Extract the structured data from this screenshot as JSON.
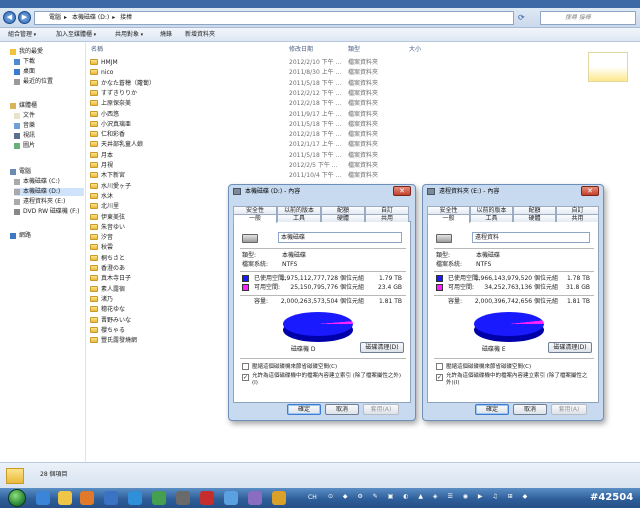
{
  "address": {
    "crumbs": [
      "電腦",
      "本機磁碟 (D:)",
      "接棒"
    ],
    "search_placeholder": "搜尋 接棒"
  },
  "toolbar": {
    "organize": "組合管理",
    "include_library": "加入至媒體櫃",
    "share": "共用對象",
    "burn": "燒錄",
    "new_folder": "新增資料夾"
  },
  "nav": {
    "favorites": "我的最愛",
    "downloads": "下載",
    "desktop": "桌面",
    "recent": "最近的位置",
    "libraries": "媒體櫃",
    "documents": "文件",
    "music": "音樂",
    "videos": "視訊",
    "pictures": "圖片",
    "computer": "電腦",
    "drive_c": "本機磁碟 (C:)",
    "drive_d": "本機磁碟 (D:)",
    "drive_e": "遠程資料夾 (E:)",
    "dvd": "DVD RW 磁碟機 (F:)",
    "network": "網路"
  },
  "columns": {
    "name": "名稱",
    "date": "修改日期",
    "type": "類型",
    "size": "大小"
  },
  "files": [
    {
      "name": "HMJM",
      "date": "2012/2/10 下午 ...",
      "type": "檔案資料夾"
    },
    {
      "name": "nico",
      "date": "2011/8/30 上午 ...",
      "type": "檔案資料夾"
    },
    {
      "name": "かなた蒼穂（蘿蔔）",
      "date": "2011/5/18 下午 ...",
      "type": "檔案資料夾"
    },
    {
      "name": "すずきりりか",
      "date": "2012/2/12 下午 ...",
      "type": "檔案資料夾"
    },
    {
      "name": "上原保奈美",
      "date": "2012/2/18 下午 ...",
      "type": "檔案資料夾"
    },
    {
      "name": "小西悠",
      "date": "2011/9/17 上午 ...",
      "type": "檔案資料夾"
    },
    {
      "name": "小沢真璃亜",
      "date": "2011/5/18 下午 ...",
      "type": "檔案資料夾"
    },
    {
      "name": "仁和彩香",
      "date": "2012/2/18 下午 ...",
      "type": "檔案資料夾"
    },
    {
      "name": "天井部乳童人娘",
      "date": "2012/1/17 上午 ...",
      "type": "檔案資料夾"
    },
    {
      "name": "月本",
      "date": "2011/5/18 下午 ...",
      "type": "檔案資料夾"
    },
    {
      "name": "月視",
      "date": "2012/2/5 下午 ...",
      "type": "檔案資料夾"
    },
    {
      "name": "木下新宮",
      "date": "2011/10/4 下午 ...",
      "type": "檔案資料夾"
    },
    {
      "name": "水川愛ヶ子",
      "date": "",
      "type": ""
    },
    {
      "name": "水沐",
      "date": "",
      "type": ""
    },
    {
      "name": "北川里",
      "date": "",
      "type": ""
    },
    {
      "name": "伊東美弦",
      "date": "",
      "type": ""
    },
    {
      "name": "朱音ゆい",
      "date": "",
      "type": ""
    },
    {
      "name": "汐音",
      "date": "",
      "type": ""
    },
    {
      "name": "秋雲",
      "date": "",
      "type": ""
    },
    {
      "name": "桐ちさと",
      "date": "",
      "type": ""
    },
    {
      "name": "香澄のあ",
      "date": "",
      "type": ""
    },
    {
      "name": "真木寺日子",
      "date": "",
      "type": ""
    },
    {
      "name": "素人露宿",
      "date": "",
      "type": ""
    },
    {
      "name": "渚乃",
      "date": "",
      "type": ""
    },
    {
      "name": "穗花ゆな",
      "date": "",
      "type": ""
    },
    {
      "name": "晋野みいな",
      "date": "",
      "type": ""
    },
    {
      "name": "櫻ちゃる",
      "date": "",
      "type": ""
    },
    {
      "name": "豐氏露發燒網",
      "date": "",
      "type": ""
    }
  ],
  "status": {
    "count": "28 個項目"
  },
  "dialogs": [
    {
      "title": "本機磁碟 (D:) - 內容",
      "tabs_row1": [
        "安全性",
        "以前的版本",
        "配額",
        "自訂"
      ],
      "tabs_row2": [
        "一般",
        "工具",
        "硬體",
        "共用"
      ],
      "name": "本機磁碟",
      "type_label": "類型:",
      "type_value": "本機磁碟",
      "fs_label": "檔案系統:",
      "fs_value": "NTFS",
      "used_label": "已使用空間:",
      "used_bytes": "1,975,112,777,728 個位元組",
      "used_h": "1.79 TB",
      "free_label": "可用空間:",
      "free_bytes": "25,150,795,776 個位元組",
      "free_h": "23.4 GB",
      "cap_label": "容量:",
      "cap_bytes": "2,000,263,573,504 個位元組",
      "cap_h": "1.81 TB",
      "drive_caption": "磁碟機 D",
      "cleanup": "磁碟清理(D)",
      "compress": "壓縮這個磁碟機來節省磁碟空間(C)",
      "index": "允許為這個磁碟機中的檔案內容建立索引 (除了檔案屬性之外)(I)",
      "ok": "確定",
      "cancel": "取消",
      "apply": "套用(A)",
      "used_fraction": 0.987
    },
    {
      "title": "遠程資料夾 (E:) - 內容",
      "tabs_row1": [
        "安全性",
        "以前的版本",
        "配額",
        "自訂"
      ],
      "tabs_row2": [
        "一般",
        "工具",
        "硬體",
        "共用"
      ],
      "name": "遠程資料",
      "type_label": "類型:",
      "type_value": "本機磁碟",
      "fs_label": "檔案系統:",
      "fs_value": "NTFS",
      "used_label": "已使用空間:",
      "used_bytes": "1,966,143,979,520 個位元組",
      "used_h": "1.78 TB",
      "free_label": "可用空間:",
      "free_bytes": "34,252,763,136 個位元組",
      "free_h": "31.8 GB",
      "cap_label": "容量:",
      "cap_bytes": "2,000,396,742,656 個位元組",
      "cap_h": "1.81 TB",
      "drive_caption": "磁碟機 E",
      "cleanup": "磁碟清理(D)",
      "compress": "壓縮這個磁碟機來節省磁碟空間(C)",
      "index": "允許為這個磁碟機中的檔案內容建立索引 (除了檔案屬性之外)(I)",
      "ok": "確定",
      "cancel": "取消",
      "apply": "套用(A)",
      "used_fraction": 0.983
    }
  ],
  "taskbar": {
    "lang": "CH",
    "watermark": "#42504"
  },
  "colors": {
    "used": "#1a1aff",
    "free": "#ff22ff",
    "taskbar": "#2f5f9a"
  }
}
